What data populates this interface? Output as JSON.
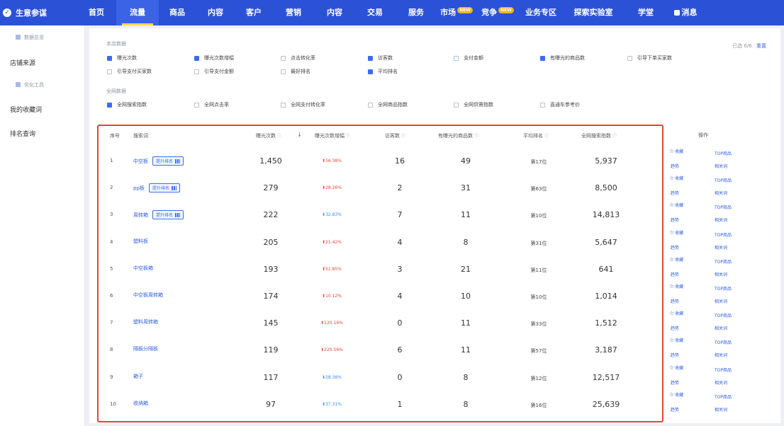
{
  "topnav": {
    "brand": "生意参谋",
    "items": [
      {
        "label": "首页"
      },
      {
        "label": "流量"
      },
      {
        "label": "商品"
      },
      {
        "label": "内容"
      },
      {
        "label": "客户"
      },
      {
        "label": "营销"
      },
      {
        "label": "内容"
      },
      {
        "label": "交易"
      },
      {
        "label": "服务"
      },
      {
        "label": "市场",
        "badge": "NEW"
      },
      {
        "label": "竞争",
        "badge": "NEW"
      },
      {
        "label": "业务专区"
      },
      {
        "label": "探索实验室"
      },
      {
        "label": "学堂"
      },
      {
        "label": "消息"
      }
    ],
    "active_index": 1
  },
  "sidebar": {
    "items": [
      {
        "label": "数据总览"
      },
      {
        "label": "店铺来源"
      },
      {
        "label": "优化工具"
      },
      {
        "label": "我的收藏词"
      },
      {
        "label": "排名查询"
      }
    ]
  },
  "filters": {
    "group1_title": "本店数据",
    "group1": [
      {
        "label": "曝光次数",
        "checked": true
      },
      {
        "label": "曝光次数增幅",
        "checked": true
      },
      {
        "label": "点击转化率",
        "checked": false
      },
      {
        "label": "访客数",
        "checked": true
      },
      {
        "label": "支付金额",
        "checked": false
      },
      {
        "label": "有曝光的商品数",
        "checked": true
      },
      {
        "label": "引导下单买家数",
        "checked": false
      },
      {
        "label": "引导支付买家数",
        "checked": false
      },
      {
        "label": "引导支付金额",
        "checked": false
      },
      {
        "label": "最好排名",
        "checked": false
      },
      {
        "label": "平均排名",
        "checked": true
      }
    ],
    "group2_title": "全网数据",
    "group2": [
      {
        "label": "全网搜索指数",
        "checked": true
      },
      {
        "label": "全网点击率",
        "checked": false
      },
      {
        "label": "全网支付转化率",
        "checked": false
      },
      {
        "label": "全网商品指数",
        "checked": false
      },
      {
        "label": "全网供需指数",
        "checked": false
      },
      {
        "label": "直通车参考价",
        "checked": false
      }
    ],
    "selected_text": "已选 6/6",
    "reset_label": "重置"
  },
  "table": {
    "headers": {
      "rank": "序号",
      "keyword": "搜索词",
      "visitors": "曝光次数",
      "rate": "曝光次数增幅",
      "intent": "访客数",
      "goods": "有曝光的商品数",
      "avg": "平均排名",
      "search": "全网搜索指数",
      "ops": "操作"
    },
    "boost_label": "提升排名",
    "ops": {
      "favorite": "收藏",
      "top_goods": "TOP商品",
      "trend": "趋势",
      "related": "相关词"
    },
    "rows": [
      {
        "rank": "1",
        "keyword": "中空板",
        "boost": true,
        "visitors": "1,450",
        "rate": "56.38%",
        "dir": "up",
        "intent": "16",
        "goods": "49",
        "avg": "第17位",
        "search": "5,937"
      },
      {
        "rank": "2",
        "keyword": "pp板",
        "boost": true,
        "visitors": "279",
        "rate": "28.26%",
        "dir": "up",
        "intent": "2",
        "goods": "31",
        "avg": "第63位",
        "search": "8,500"
      },
      {
        "rank": "3",
        "keyword": "周转箱",
        "boost": true,
        "visitors": "222",
        "rate": "32.83%",
        "dir": "down",
        "intent": "7",
        "goods": "11",
        "avg": "第10位",
        "search": "14,813"
      },
      {
        "rank": "4",
        "keyword": "塑料板",
        "boost": false,
        "visitors": "205",
        "rate": "21.42%",
        "dir": "up",
        "intent": "4",
        "goods": "8",
        "avg": "第31位",
        "search": "5,647"
      },
      {
        "rank": "5",
        "keyword": "中空板箱",
        "boost": false,
        "visitors": "193",
        "rate": "51.85%",
        "dir": "up",
        "intent": "3",
        "goods": "21",
        "avg": "第11位",
        "search": "641"
      },
      {
        "rank": "6",
        "keyword": "中空板周转箱",
        "boost": false,
        "visitors": "174",
        "rate": "10.12%",
        "dir": "up",
        "intent": "4",
        "goods": "10",
        "avg": "第10位",
        "search": "1,014"
      },
      {
        "rank": "7",
        "keyword": "塑料周转箱",
        "boost": false,
        "visitors": "145",
        "rate": "120.16%",
        "dir": "up",
        "intent": "0",
        "goods": "11",
        "avg": "第33位",
        "search": "1,512"
      },
      {
        "rank": "8",
        "keyword": "隔板分隔板",
        "boost": false,
        "visitors": "119",
        "rate": "220.56%",
        "dir": "up",
        "intent": "6",
        "goods": "11",
        "avg": "第57位",
        "search": "3,187"
      },
      {
        "rank": "9",
        "keyword": "箱子",
        "boost": false,
        "visitors": "117",
        "rate": "28.38%",
        "dir": "down",
        "intent": "0",
        "goods": "8",
        "avg": "第12位",
        "search": "12,517"
      },
      {
        "rank": "10",
        "keyword": "收纳箱",
        "boost": false,
        "visitors": "97",
        "rate": "37.31%",
        "dir": "down",
        "intent": "1",
        "goods": "8",
        "avg": "第16位",
        "search": "25,639"
      }
    ]
  },
  "colors": {
    "nav": "#2b52d6",
    "accent": "#3b6cf0",
    "up": "#e0463a",
    "down": "#3b8df0",
    "highlight": "#e0463a"
  }
}
